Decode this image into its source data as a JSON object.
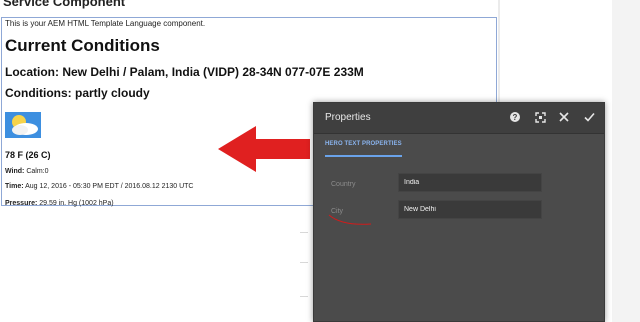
{
  "page": {
    "title": "Service Component"
  },
  "component": {
    "intro": "This is your AEM HTML Template Language component.",
    "heading": "Current Conditions",
    "location": "Location: New Delhi / Palam, India (VIDP) 28-34N 077-07E 233M",
    "conditions": "Conditions: partly cloudy",
    "weather_icon": "partly-cloudy-icon",
    "temperature": "78 F (26 C)",
    "wind_label": "Wind:",
    "wind_value": " Calm:0",
    "time_label": "Time:",
    "time_value": " Aug 12, 2016 - 05:30 PM EDT / 2016.08.12 2130 UTC",
    "pressure_label": "Pressure:",
    "pressure_value": " 29.59 in. Hg (1002 hPa)"
  },
  "annotation": {
    "arrow_color": "#e02020"
  },
  "dialog": {
    "title": "Properties",
    "help_icon": "help-icon",
    "fullscreen_icon": "fullscreen-icon",
    "close_icon": "close-icon",
    "done_icon": "check-icon",
    "tab_label": "HERO TEXT PROPERTIES",
    "fields": {
      "country": {
        "label": "Country",
        "value": "India"
      },
      "city": {
        "label": "City",
        "value": "New Delhi"
      }
    }
  },
  "colors": {
    "dialog_bg": "#4b4b4b",
    "header_bg": "#3f3f3f",
    "tab_accent": "#6aa3ea",
    "component_border": "#8fa8d6"
  }
}
